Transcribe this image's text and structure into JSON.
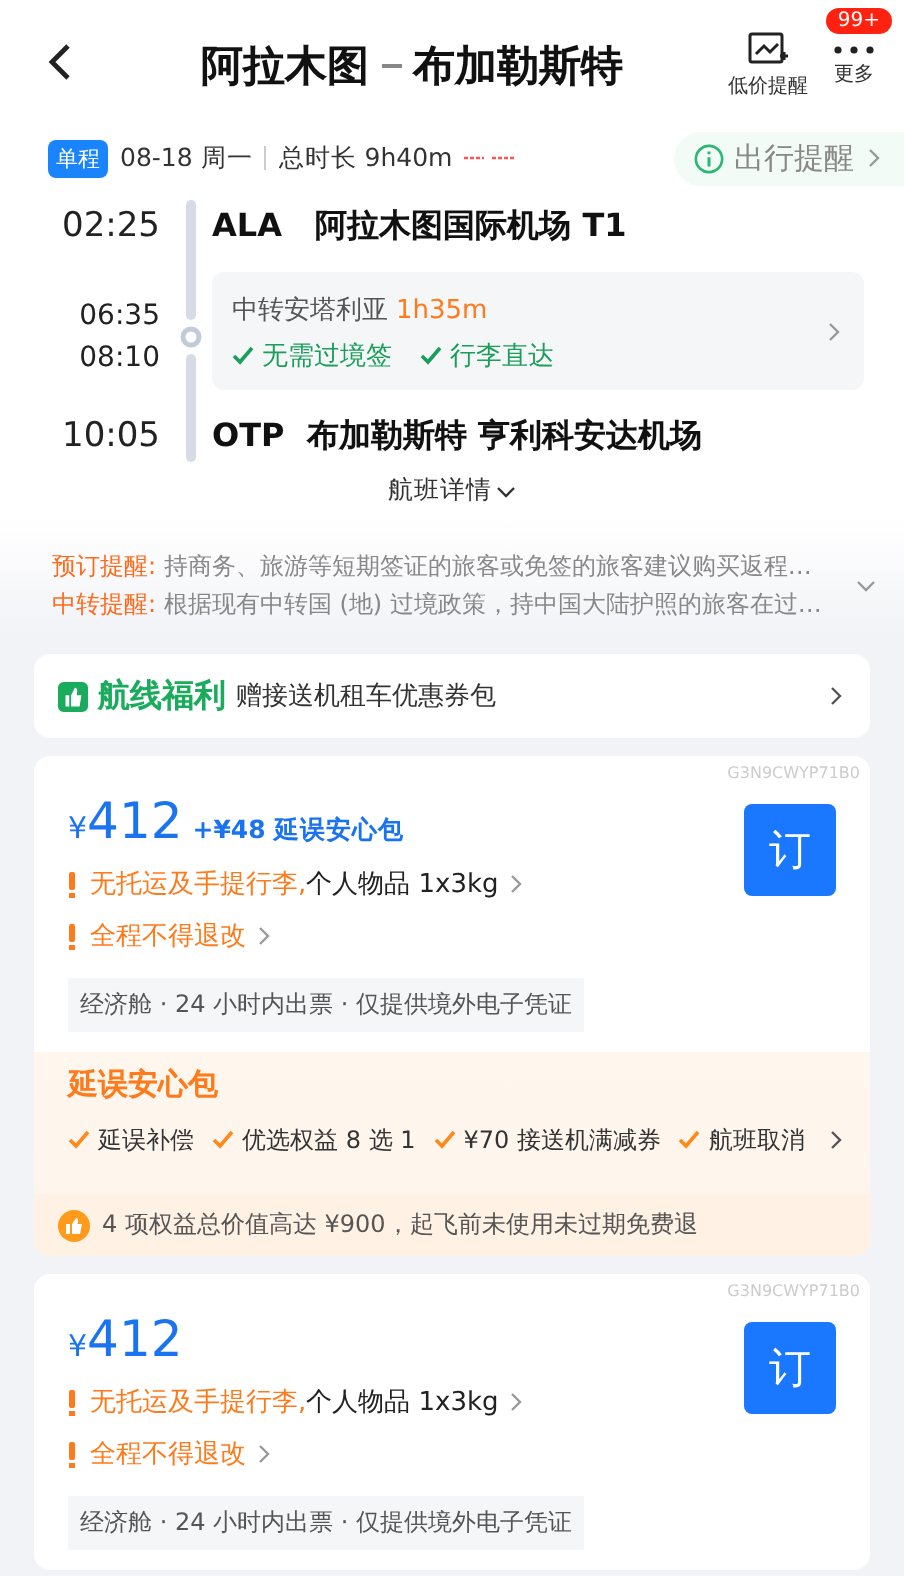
{
  "header": {
    "title_from": "阿拉木图",
    "title_to": "布加勒斯特",
    "actions": [
      {
        "kind": "alert",
        "label": "低价提醒"
      },
      {
        "kind": "more",
        "label": "更多",
        "badge": "99+"
      }
    ]
  },
  "trip": {
    "tag": "单程",
    "date": "08-18 周一",
    "duration": "总时长 9h40m",
    "reminder": "出行提醒"
  },
  "timeline": {
    "depart": {
      "time": "02:25",
      "code": "ALA",
      "airport": "阿拉木图国际机场 T1"
    },
    "transfer": {
      "arrive": "06:35",
      "leave": "08:10",
      "city": "中转安塔利亚",
      "wait": "1h35m",
      "checks": [
        "无需过境签",
        "行李直达"
      ]
    },
    "arrive": {
      "time": "10:05",
      "code": "OTP",
      "airport": "布加勒斯特 亨利科安达机场"
    },
    "details": "航班详情"
  },
  "notices": [
    {
      "label": "预订提醒:",
      "text": "持商务、旅游等短期签证的旅客或免签的旅客建议购买返程…"
    },
    {
      "label": "中转提醒:",
      "text": "根据现有中转国 (地) 过境政策，持中国大陆护照的旅客在过…"
    }
  ],
  "benefit": {
    "title": "航线福利",
    "text": "赠接送机租车优惠券包"
  },
  "offers": [
    {
      "code": "G3N9CWYP71B0",
      "currency": "¥",
      "price": "412",
      "addon": "+¥48 延误安心包",
      "warnings": [
        {
          "label": "无托运及手提行李,",
          "detail": "个人物品 1x3kg"
        },
        {
          "label": "全程不得退改"
        }
      ],
      "tags": "经济舱 · 24 小时内出票 · 仅提供境外电子凭证",
      "book": "订",
      "insurance": {
        "title": "延误安心包",
        "items": [
          "延误补偿",
          "优选权益 8 选 1",
          "¥70 接送机满减券",
          "航班取消"
        ],
        "footer": "4 项权益总价值高达 ¥900，起飞前未使用未过期免费退"
      }
    },
    {
      "code": "G3N9CWYP71B0",
      "currency": "¥",
      "price": "412",
      "warnings": [
        {
          "label": "无托运及手提行李,",
          "detail": "个人物品 1x3kg"
        },
        {
          "label": "全程不得退改"
        }
      ],
      "tags": "经济舱 · 24 小时内出票 · 仅提供境外电子凭证",
      "book": "订"
    }
  ]
}
